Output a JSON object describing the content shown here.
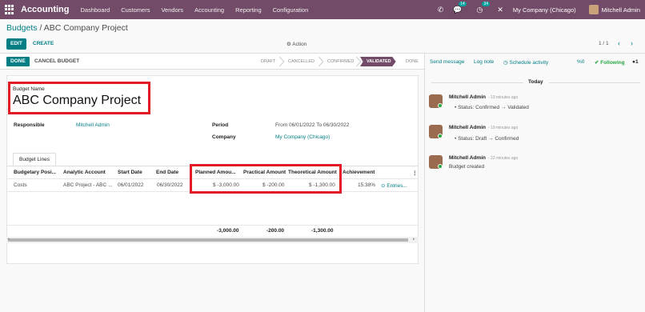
{
  "navbar": {
    "brand": "Accounting",
    "menu": [
      "Dashboard",
      "Customers",
      "Vendors",
      "Accounting",
      "Reporting",
      "Configuration"
    ],
    "messages_count": "14",
    "activities_count": "34",
    "company": "My Company (Chicago)",
    "user": "Mitchell Admin"
  },
  "control": {
    "breadcrumb_parent": "Budgets",
    "breadcrumb_sep": " / ",
    "breadcrumb_current": "ABC Company Project",
    "edit_label": "EDIT",
    "create_label": "CREATE",
    "action_label": "Action",
    "pager": "1 / 1"
  },
  "statusbar": {
    "done_label": "DONE",
    "cancel_label": "CANCEL BUDGET",
    "stages": [
      "DRAFT",
      "CANCELLED",
      "CONFIRMED",
      "VALIDATED",
      "DONE"
    ],
    "active_stage": "VALIDATED"
  },
  "form": {
    "name_label": "Budget Name",
    "name_value": "ABC Company Project",
    "responsible_label": "Responsible",
    "responsible_value": "Mitchell Admin",
    "period_label": "Period",
    "period_value": "From 06/01/2022 To 06/30/2022",
    "company_label": "Company",
    "company_value": "My Company (Chicago)"
  },
  "budget_lines": {
    "tab_label": "Budget Lines",
    "columns": [
      "Budgetary Posi...",
      "Analytic Account",
      "Start Date",
      "End Date",
      "Planned Amou...",
      "Practical Amount",
      "Theoretical Amount",
      "Achievement"
    ],
    "rows": [
      {
        "position": "Costs",
        "account": "ABC Project - ABC ...",
        "start": "06/01/2022",
        "end": "06/30/2022",
        "planned": "$ -3,000.00",
        "practical": "$ -200.00",
        "theoretical": "$ -1,300.00",
        "achievement": "15.38%",
        "entries_label": "Entries..."
      }
    ],
    "totals": {
      "planned": "-3,000.00",
      "practical": "-200.00",
      "theoretical": "-1,300.00"
    }
  },
  "chatter": {
    "send_message": "Send message",
    "log_note": "Log note",
    "schedule_activity": "Schedule activity",
    "attachments": "0",
    "following": "Following",
    "followers": "1",
    "today_label": "Today",
    "messages": [
      {
        "author": "Mitchell Admin",
        "time": "- 19 minutes ago",
        "text": "Status: Confirmed → Validated"
      },
      {
        "author": "Mitchell Admin",
        "time": "- 19 minutes ago",
        "text": "Status: Draft → Confirmed"
      },
      {
        "author": "Mitchell Admin",
        "time": "- 22 minutes ago",
        "text": "Budget created"
      }
    ]
  },
  "colors": {
    "brand": "#714b67",
    "accent": "#017e84",
    "highlight": "#e01b24"
  }
}
